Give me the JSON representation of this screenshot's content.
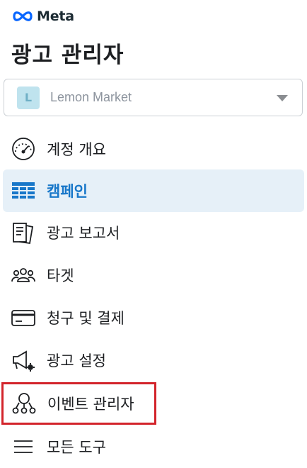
{
  "brand": {
    "name": "Meta"
  },
  "page": {
    "title": "광고 관리자"
  },
  "account": {
    "initial": "L",
    "name": "Lemon Market"
  },
  "nav": {
    "items": [
      {
        "label": "계정 개요",
        "icon": "gauge-icon"
      },
      {
        "label": "캠페인",
        "icon": "grid-icon",
        "active": true
      },
      {
        "label": "광고 보고서",
        "icon": "report-icon"
      },
      {
        "label": "타겟",
        "icon": "people-icon"
      },
      {
        "label": "청구 및 결제",
        "icon": "credit-card-icon"
      },
      {
        "label": "광고 설정",
        "icon": "megaphone-settings-icon"
      },
      {
        "label": "이벤트 관리자",
        "icon": "event-network-icon",
        "highlighted": true
      },
      {
        "label": "모든 도구",
        "icon": "menu-icon"
      }
    ]
  },
  "colors": {
    "accent": "#1877c9",
    "active_bg": "#e6f0f8",
    "highlight_border": "#d3242b"
  }
}
